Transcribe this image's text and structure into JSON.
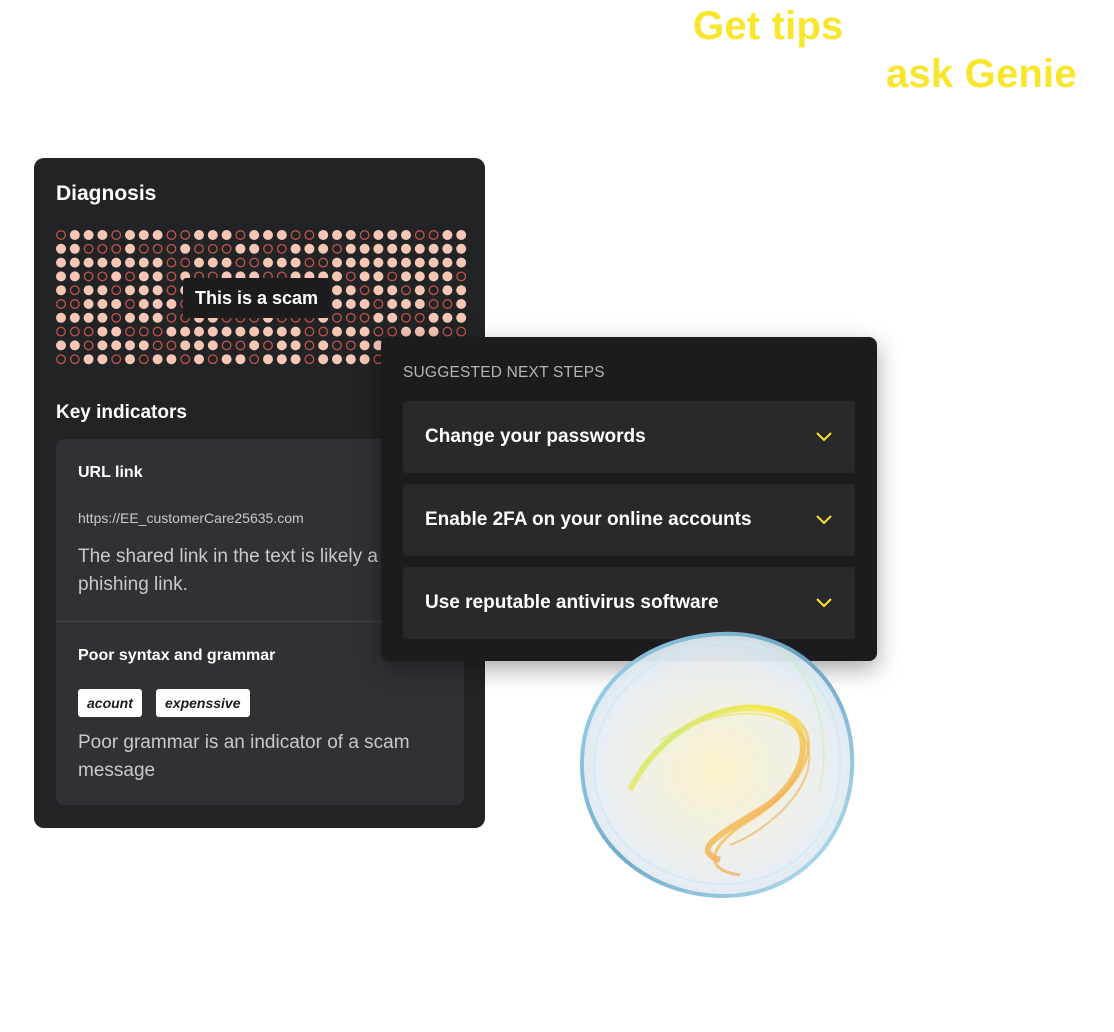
{
  "headline": {
    "line1": "Get tips",
    "line2": "ask Genie"
  },
  "diagnosis": {
    "title": "Diagnosis",
    "verdict": "This is a scam",
    "key_indicators_title": "Key indicators",
    "indicators": [
      {
        "title": "URL link",
        "url": "https://EE_customerCare25635.com",
        "description": "The shared link in the text is likely a phishing link."
      },
      {
        "title": "Poor syntax and grammar",
        "tags": [
          "acount",
          "expenssive"
        ],
        "description": "Poor grammar is an indicator of a scam message"
      }
    ]
  },
  "next_steps": {
    "title": "SUGGESTED NEXT STEPS",
    "items": [
      {
        "label": "Change your passwords",
        "icon": "chevron-down-icon"
      },
      {
        "label": "Enable 2FA on your online accounts",
        "icon": "chevron-down-icon"
      },
      {
        "label": "Use reputable antivirus software",
        "icon": "chevron-down-icon"
      }
    ]
  },
  "colors": {
    "accent_yellow": "#f7e62c",
    "panel_bg": "#222325",
    "dot_fill": "#f7c6b4",
    "dot_ring": "#c2544b"
  }
}
